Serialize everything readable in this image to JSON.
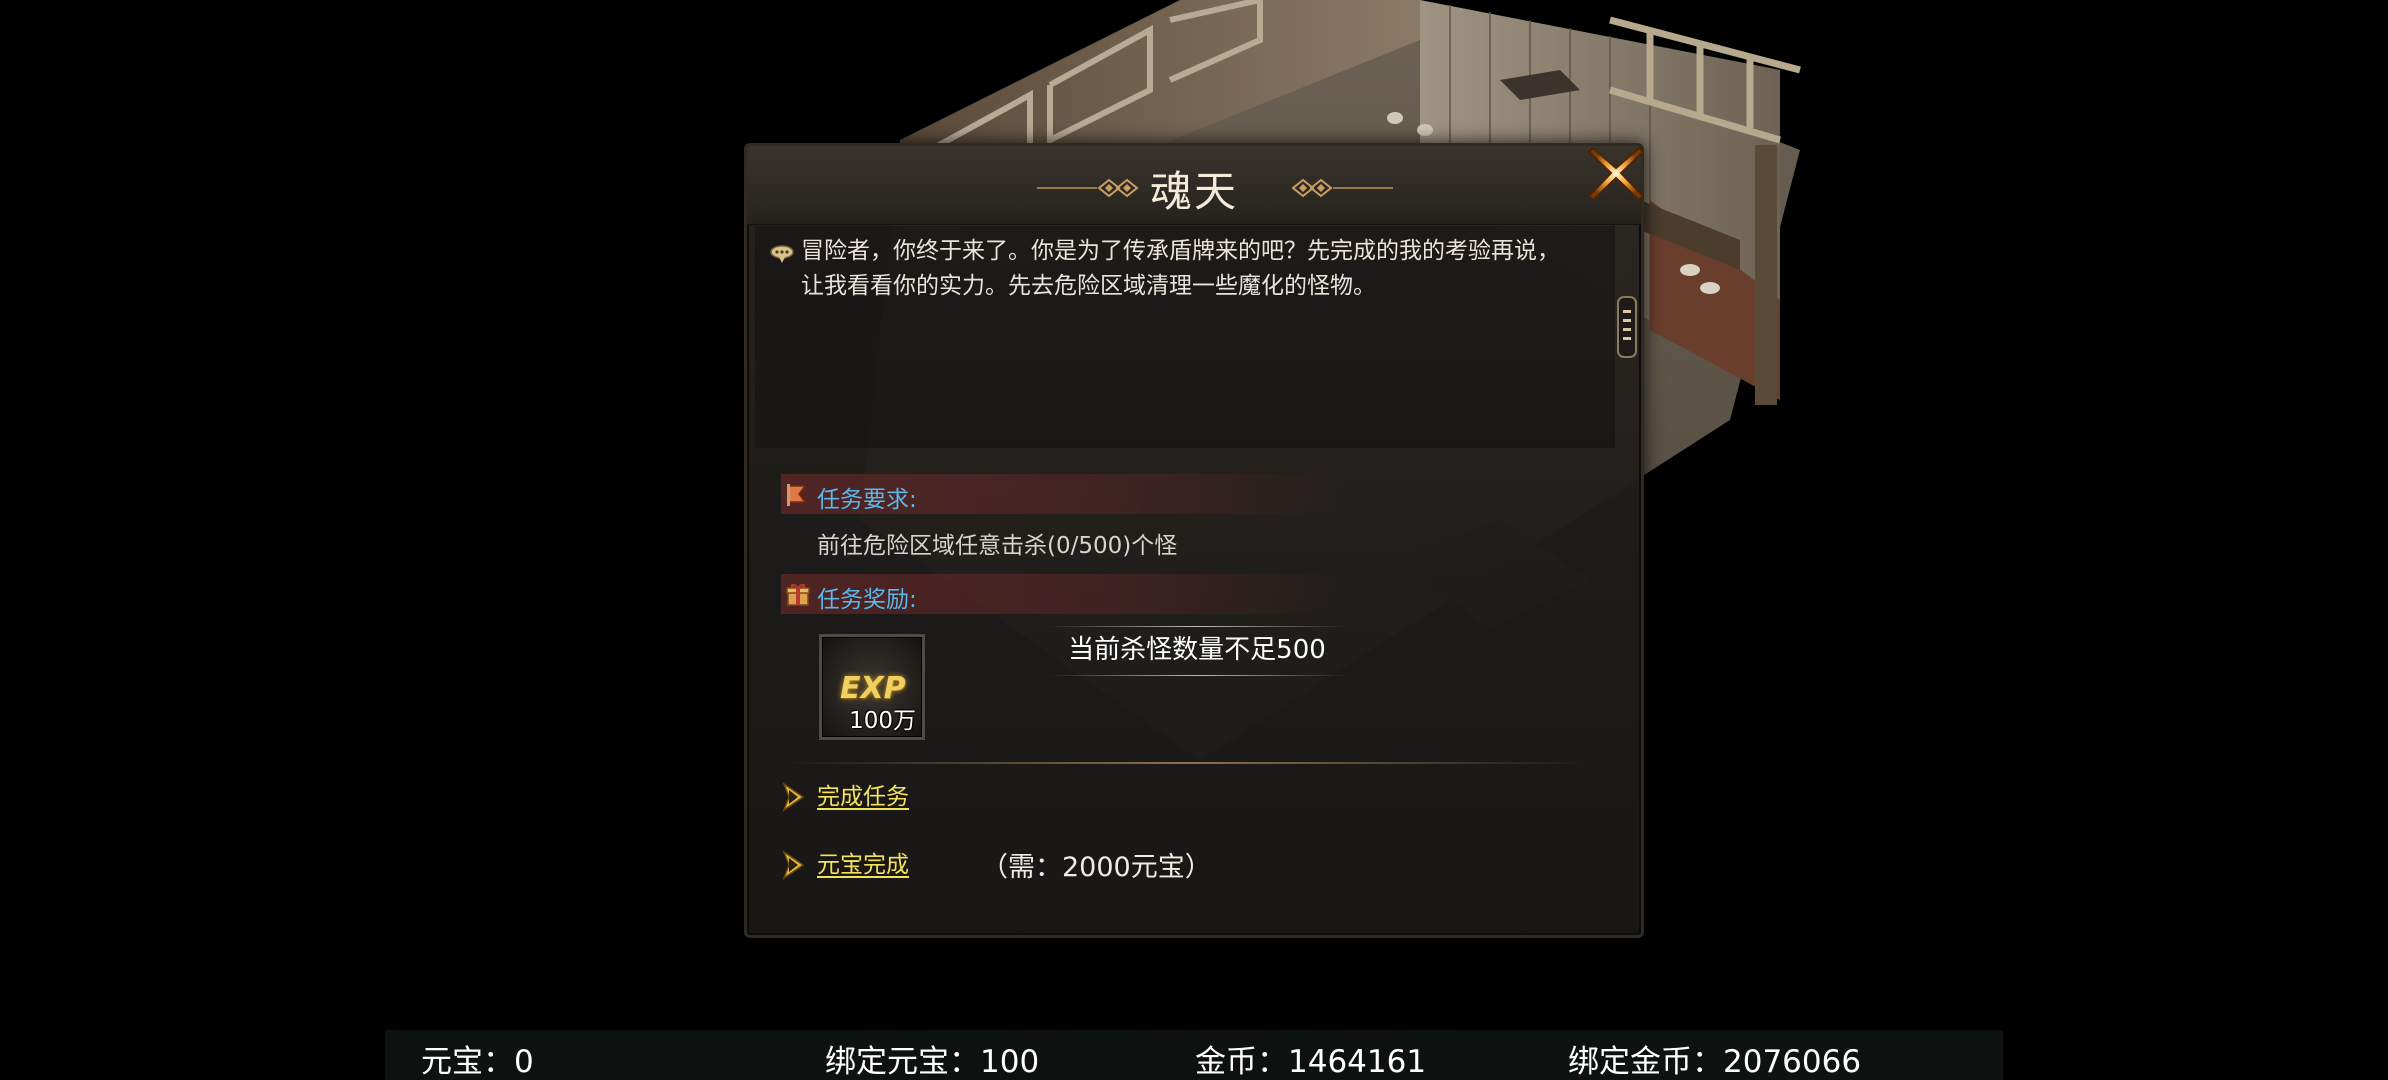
{
  "dialog": {
    "npc_name": "魂天",
    "speech_lines": [
      "冒险者，你终于来了。你是为了传承盾牌来的吧？先完成的我的考验再说，",
      "让我看看你的实力。先去危险区域清理一些魔化的怪物。"
    ],
    "requirement": {
      "header": "任务要求:",
      "text": "前往危险区域任意击杀(0/500)个怪"
    },
    "reward": {
      "header": "任务奖励:",
      "item_icon": "exp-icon",
      "item_label": "EXP",
      "item_amount": "100万"
    },
    "kill_notice": "当前杀怪数量不足500",
    "actions": {
      "complete_label": "完成任务",
      "ingot_complete_label": "元宝完成",
      "ingot_cost": "（需：2000元宝）"
    }
  },
  "currency_bar": {
    "ingot": "元宝：0",
    "bound_ingot": "绑定元宝：100",
    "gold": "金币：1464161",
    "bound_gold": "绑定金币：2076066"
  },
  "colors": {
    "section_header_text": "#5db6ea",
    "action_link": "#f2e35a",
    "exp_gold": "#f0d060",
    "section_header_bg": "#7a2c2c"
  }
}
